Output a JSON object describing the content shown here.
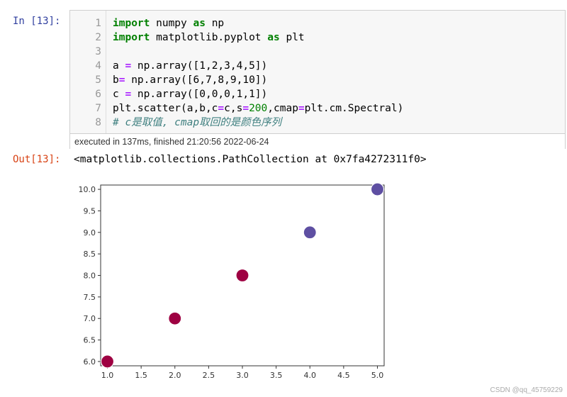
{
  "cell": {
    "in_prompt": "In [13]:",
    "out_prompt": "Out[13]:",
    "lines": [
      {
        "no": "1",
        "tokens": [
          {
            "t": "import",
            "c": "kw"
          },
          {
            "t": " numpy "
          },
          {
            "t": "as",
            "c": "kw"
          },
          {
            "t": " np"
          }
        ]
      },
      {
        "no": "2",
        "tokens": [
          {
            "t": "import",
            "c": "kw"
          },
          {
            "t": " matplotlib.pyplot "
          },
          {
            "t": "as",
            "c": "kw"
          },
          {
            "t": " plt"
          }
        ]
      },
      {
        "no": "3",
        "tokens": []
      },
      {
        "no": "4",
        "tokens": [
          {
            "t": "a "
          },
          {
            "t": "=",
            "c": "op"
          },
          {
            "t": " np.array([1,2,3,4,5])"
          }
        ]
      },
      {
        "no": "5",
        "tokens": [
          {
            "t": "b"
          },
          {
            "t": "=",
            "c": "op"
          },
          {
            "t": " np.array([6,7,8,9,10])"
          }
        ]
      },
      {
        "no": "6",
        "tokens": [
          {
            "t": "c "
          },
          {
            "t": "=",
            "c": "op"
          },
          {
            "t": " np.array([0,0,0,1,1])"
          }
        ]
      },
      {
        "no": "7",
        "tokens": [
          {
            "t": "plt.scatter(a,b,c"
          },
          {
            "t": "=",
            "c": "op"
          },
          {
            "t": "c,s"
          },
          {
            "t": "=",
            "c": "op"
          },
          {
            "t": "200",
            "c": "num"
          },
          {
            "t": ",cmap"
          },
          {
            "t": "=",
            "c": "op"
          },
          {
            "t": "plt.cm.Spectral)"
          }
        ]
      },
      {
        "no": "8",
        "tokens": [
          {
            "t": "# c是取值, cmap取回的是颜色序列",
            "c": "cm"
          }
        ]
      }
    ],
    "exec_info": "executed in 137ms, finished 21:20:56 2022-06-24",
    "output_text": "<matplotlib.collections.PathCollection at 0x7fa4272311f0>"
  },
  "chart_data": {
    "type": "scatter",
    "title": "",
    "xlabel": "",
    "ylabel": "",
    "x": [
      1,
      2,
      3,
      4,
      5
    ],
    "y": [
      6,
      7,
      8,
      9,
      10
    ],
    "point_colors": [
      "#9e0142",
      "#9e0142",
      "#9e0142",
      "#5e4fa2",
      "#5e4fa2"
    ],
    "xlim": [
      0.9,
      5.1
    ],
    "ylim": [
      5.9,
      10.1
    ],
    "xticks": [
      "1.0",
      "1.5",
      "2.0",
      "2.5",
      "3.0",
      "3.5",
      "4.0",
      "4.5",
      "5.0"
    ],
    "yticks": [
      "6.0",
      "6.5",
      "7.0",
      "7.5",
      "8.0",
      "8.5",
      "9.0",
      "9.5",
      "10.0"
    ],
    "grid": false
  },
  "watermark": "CSDN @qq_45759229"
}
